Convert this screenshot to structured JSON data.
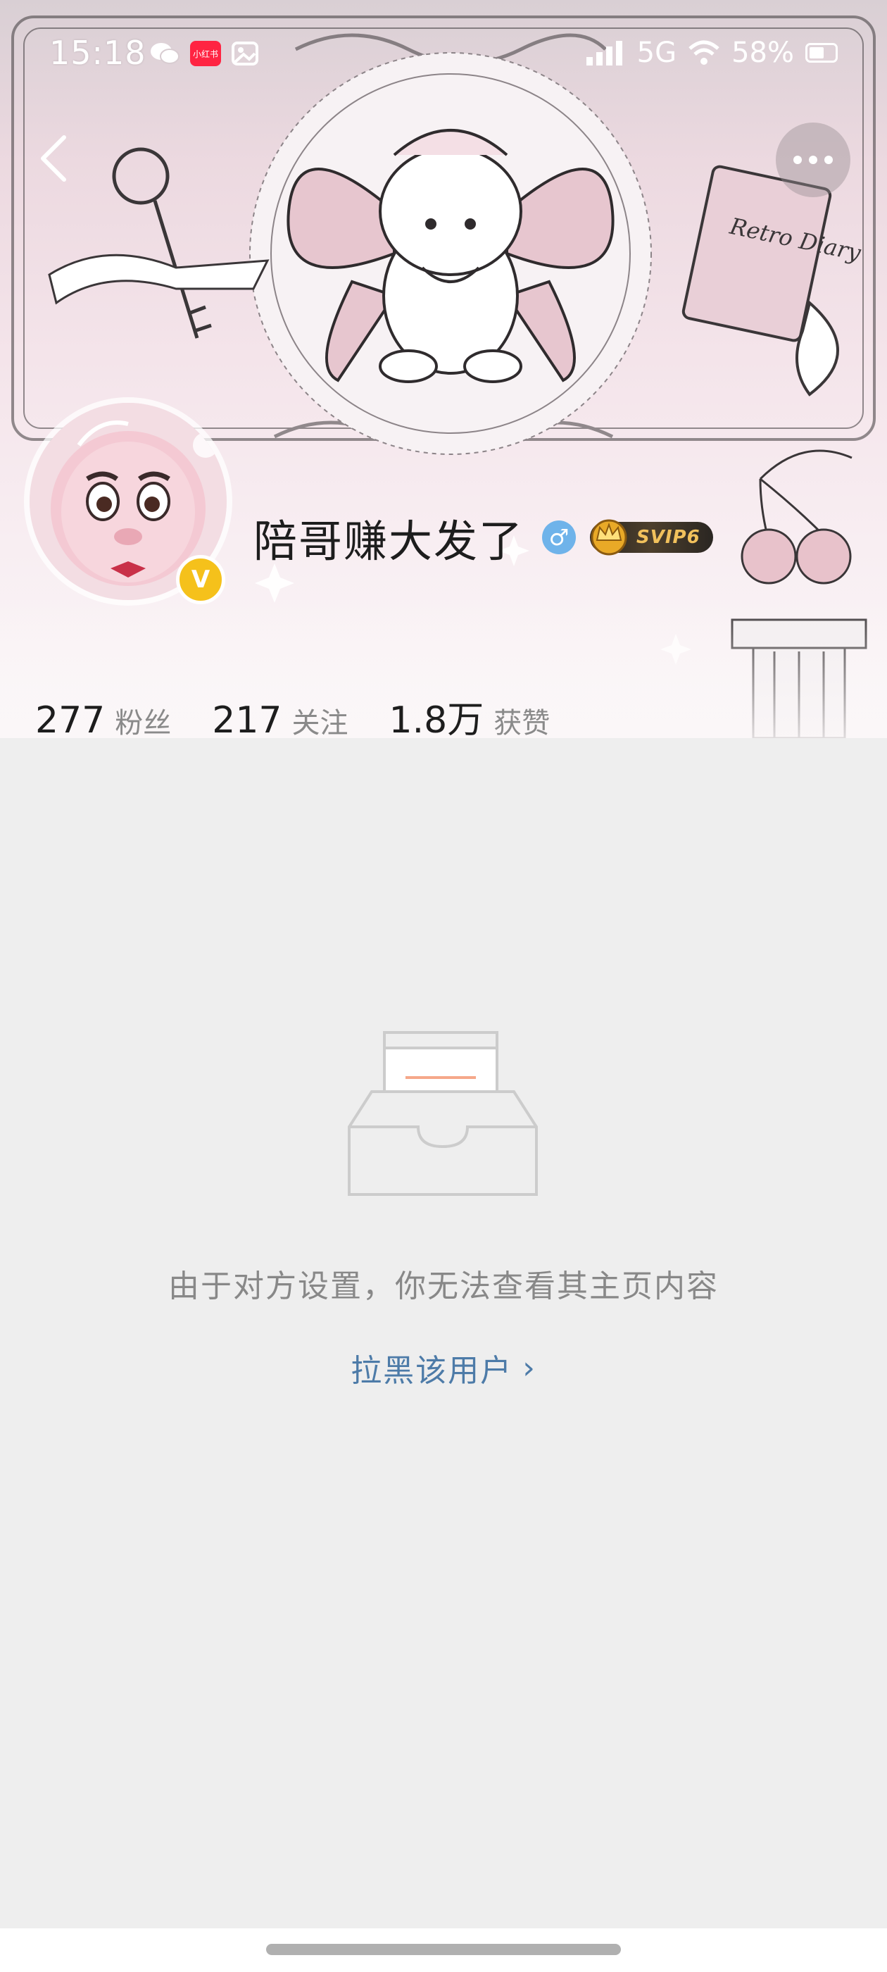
{
  "status_bar": {
    "time": "15:18",
    "app_badge": "小红书",
    "network": "5G",
    "battery": "58%",
    "battery_level": 0.58
  },
  "header": {
    "banner_text": "Retro Diary"
  },
  "profile": {
    "name": "陪哥赚大发了",
    "gender_symbol": "♂",
    "vip_label": "SVIP6",
    "verified_mark": "V"
  },
  "stats": [
    {
      "value": "277",
      "label": "粉丝"
    },
    {
      "value": "217",
      "label": "关注"
    },
    {
      "value": "1.8万",
      "label": "获赞"
    }
  ],
  "content": {
    "restricted_message": "由于对方设置，你无法查看其主页内容",
    "block_link_label": "拉黑该用户",
    "block_link_arrow": "›"
  },
  "colors": {
    "link": "#4d7ba8",
    "vip_gold": "#f2c15c",
    "verified_yellow": "#f5c11b",
    "gender_blue": "#6fb3ea",
    "background": "#eeeeee"
  }
}
